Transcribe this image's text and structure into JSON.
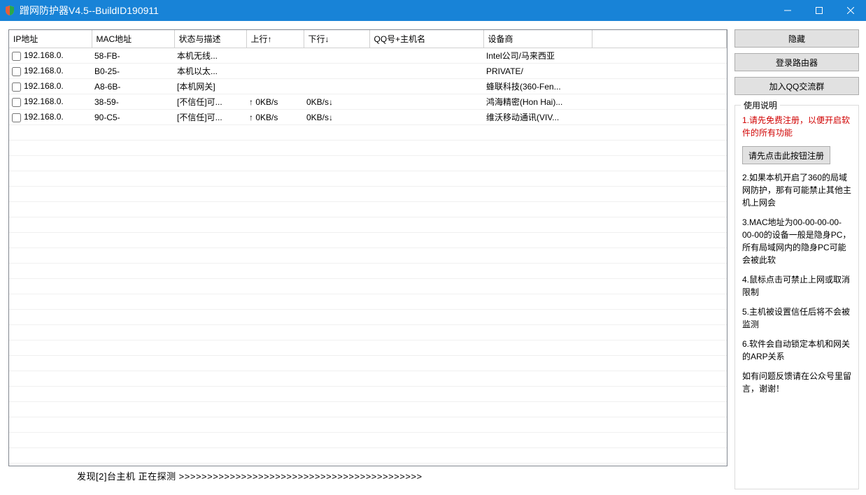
{
  "window": {
    "title": "蹭网防护器V4.5--BuildID190911"
  },
  "table": {
    "headers": {
      "ip": "IP地址",
      "mac": "MAC地址",
      "status": "状态与描述",
      "up": "上行↑",
      "down": "下行↓",
      "qq": "QQ号+主机名",
      "vendor": "设备商"
    },
    "rows": [
      {
        "ip": "192.168.0.",
        "mac": "58-FB-",
        "status": "本机无线...",
        "up": "",
        "down": "",
        "qq": "",
        "vendor": "Intel公司/马来西亚"
      },
      {
        "ip": "192.168.0.",
        "mac": "B0-25-",
        "status": "本机以太...",
        "up": "",
        "down": "",
        "qq": "",
        "vendor": "PRIVATE/"
      },
      {
        "ip": "192.168.0.",
        "mac": "A8-6B-",
        "status": "[本机网关]",
        "up": "",
        "down": "",
        "qq": "",
        "vendor": "蜂联科技(360-Fen..."
      },
      {
        "ip": "192.168.0.",
        "mac": "38-59-",
        "status": "[不信任]可...",
        "up": "↑   0KB/s",
        "down": "0KB/s↓",
        "qq": "",
        "vendor": "鸿海精密(Hon Hai)..."
      },
      {
        "ip": "192.168.0.",
        "mac": "90-C5-",
        "status": "[不信任]可...",
        "up": "↑   0KB/s",
        "down": "0KB/s↓",
        "qq": "",
        "vendor": "维沃移动通讯(VIV..."
      }
    ]
  },
  "side": {
    "btn_hide": "隐藏",
    "btn_router": "登录路由器",
    "btn_qq_group": "加入QQ交流群",
    "instructions": {
      "legend": "使用说明",
      "line1": "1.请先免费注册，以便开启软件的所有功能",
      "btn_register": "请先点击此按钮注册",
      "line2": "2.如果本机开启了360的局域网防护，那有可能禁止其他主机上网会",
      "line3": "3.MAC地址为00-00-00-00-00-00的设备一般是隐身PC，所有局域网内的隐身PC可能会被此软",
      "line4": "4.鼠标点击可禁止上网或取消限制",
      "line5": "5.主机被设置信任后将不会被监测",
      "line6": "6.软件会自动锁定本机和网关的ARP关系",
      "footer": "如有问题反馈请在公众号里留言，谢谢！"
    }
  },
  "statusbar": {
    "text": "发现[2]台主机   正在探测 >>>>>>>>>>>>>>>>>>>>>>>>>>>>>>>>>>>>>>>>>>>"
  }
}
